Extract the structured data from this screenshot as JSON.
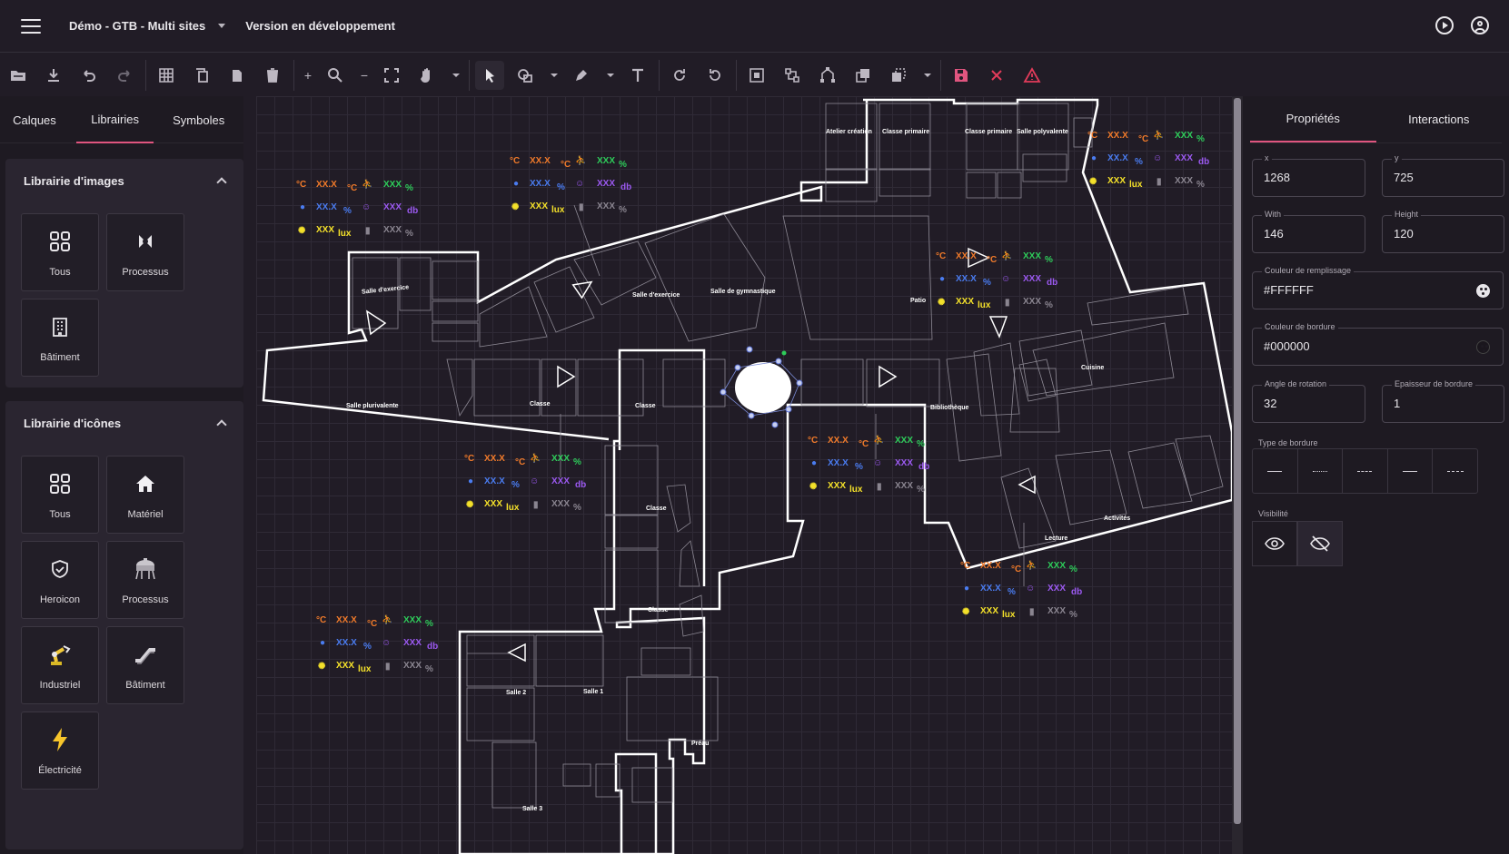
{
  "header": {
    "project": "Démo - GTB - Multi sites",
    "version": "Version en développement"
  },
  "left": {
    "tabs": [
      "Calques",
      "Librairies",
      "Symboles"
    ],
    "images_title": "Librairie d'images",
    "images": [
      "Tous",
      "Processus",
      "Bâtiment"
    ],
    "icons_title": "Librairie d'icônes",
    "icons": [
      "Tous",
      "Matériel",
      "Heroicon",
      "Processus",
      "Industriel",
      "Bâtiment",
      "Électricité"
    ]
  },
  "right": {
    "tabs": [
      "Propriétés",
      "Interactions"
    ],
    "x_label": "x",
    "x": "1268",
    "y_label": "y",
    "y": "725",
    "width_label": "With",
    "width": "146",
    "height_label": "Height",
    "height": "120",
    "fill_label": "Couleur de remplissage",
    "fill": "#FFFFFF",
    "border_color_label": "Couleur de bordure",
    "border_color": "#000000",
    "rotation_label": "Angle de rotation",
    "rotation": "32",
    "border_width_label": "Epaisseur de bordure",
    "border_width": "1",
    "border_type_label": "Type de bordure",
    "visibility_label": "Visibilité"
  },
  "plan": {
    "rooms": [
      "Atelier création",
      "Classe primaire",
      "Classe primaire",
      "Salle polyvalente",
      "Salle d'exercice",
      "Salle d'exercice",
      "Salle de gymnastique",
      "Patio",
      "Cuisine",
      "Salle plurivalente",
      "Classe",
      "Classe",
      "Bibliothèque",
      "Classe",
      "Classe",
      "Activités",
      "Lecture",
      "Salle 2",
      "Salle 1",
      "Préau",
      "Salle 3"
    ],
    "sensor": {
      "temp": "XX.X",
      "temp_unit": "°C",
      "hum": "XX.X",
      "hum_unit": "%",
      "lux": "XXX",
      "lux_unit": "lux",
      "pres": "XXX",
      "pres_unit": "%",
      "noise": "XXX",
      "noise_unit": "db",
      "bat": "XXX",
      "bat_unit": "%",
      "deg": "°C"
    }
  },
  "colors": {
    "accent": "#e0557f",
    "temp": "#f07a2a",
    "hum": "#4a7cf0",
    "lux": "#f4e12a",
    "presence": "#2ecc5a",
    "noise": "#9b59f0",
    "battery": "#8a8590",
    "danger": "#e23b5a"
  }
}
